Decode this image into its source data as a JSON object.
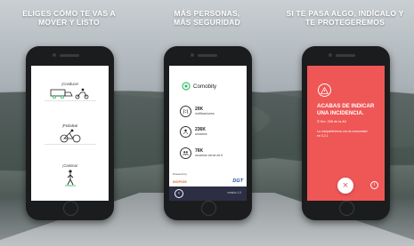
{
  "panels": [
    {
      "heading": [
        "ELIGES CÓMO TE VAS A",
        "MOVER Y LISTO"
      ],
      "modes": [
        "¡Conduce!",
        "¡Pedalea!",
        "¡Camina!"
      ]
    },
    {
      "heading": [
        "MÁS PERSONAS,",
        "MÁS SEGURIDAD"
      ],
      "brand": "Comobity",
      "stats": [
        {
          "value": "20K",
          "caption": "notificaciones"
        },
        {
          "value": "236K",
          "caption": "usuarios"
        },
        {
          "value": "76K",
          "caption": "usuarios cerca de ti"
        }
      ],
      "powered_by": "Powered by",
      "inspide": "INSPIDE",
      "dgt": "DGT",
      "version": "versión 1.0"
    },
    {
      "heading": [
        "SI TE PASA ALGO, INDÍCALO Y",
        "TE PROTEGEREMOS"
      ],
      "alert_title": [
        "ACABAS DE INDICAR",
        "UNA INCIDENCIA."
      ],
      "location": "Km. 206 de la A3",
      "share_text": "La compartiremos con la comunidad en 3,2,1"
    }
  ],
  "colors": {
    "alert_red": "#ef5656",
    "accent_green": "#3fbf6f",
    "nav_dark": "#2c2f44"
  }
}
